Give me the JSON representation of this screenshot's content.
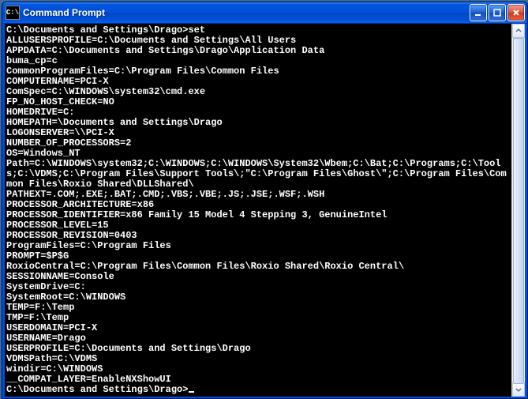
{
  "titlebar": {
    "icon_text": "C:\\",
    "title": "Command Prompt"
  },
  "terminal": {
    "lines": [
      "",
      "C:\\Documents and Settings\\Drago>set",
      "ALLUSERSPROFILE=C:\\Documents and Settings\\All Users",
      "APPDATA=C:\\Documents and Settings\\Drago\\Application Data",
      "buma_cp=c",
      "CommonProgramFiles=C:\\Program Files\\Common Files",
      "COMPUTERNAME=PCI-X",
      "ComSpec=C:\\WINDOWS\\system32\\cmd.exe",
      "FP_NO_HOST_CHECK=NO",
      "HOMEDRIVE=C:",
      "HOMEPATH=\\Documents and Settings\\Drago",
      "LOGONSERVER=\\\\PCI-X",
      "NUMBER_OF_PROCESSORS=2",
      "OS=Windows_NT",
      "Path=C:\\WINDOWS\\system32;C:\\WINDOWS;C:\\WINDOWS\\System32\\Wbem;C:\\Bat;C:\\Programs;C:\\Tools;C:\\VDMS;C:\\Program Files\\Support Tools\\;\"C:\\Program Files\\Ghost\\\";C:\\Program Files\\Common Files\\Roxio Shared\\DLLShared\\",
      "PATHEXT=.COM;.EXE;.BAT;.CMD;.VBS;.VBE;.JS;.JSE;.WSF;.WSH",
      "PROCESSOR_ARCHITECTURE=x86",
      "PROCESSOR_IDENTIFIER=x86 Family 15 Model 4 Stepping 3, GenuineIntel",
      "PROCESSOR_LEVEL=15",
      "PROCESSOR_REVISION=0403",
      "ProgramFiles=C:\\Program Files",
      "PROMPT=$P$G",
      "RoxioCentral=C:\\Program Files\\Common Files\\Roxio Shared\\Roxio Central\\",
      "SESSIONNAME=Console",
      "SystemDrive=C:",
      "SystemRoot=C:\\WINDOWS",
      "TEMP=F:\\Temp",
      "TMP=F:\\Temp",
      "USERDOMAIN=PCI-X",
      "USERNAME=Drago",
      "USERPROFILE=C:\\Documents and Settings\\Drago",
      "VDMSPath=C:\\VDMS",
      "windir=C:\\WINDOWS",
      "__COMPAT_LAYER=EnableNXShowUI",
      ""
    ],
    "prompt": "C:\\Documents and Settings\\Drago>"
  }
}
